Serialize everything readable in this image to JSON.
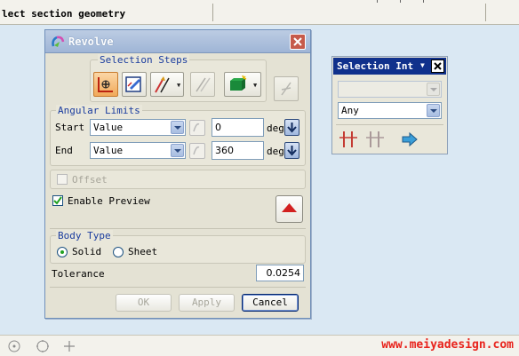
{
  "cue_line": {
    "text": "lect section geometry"
  },
  "dialog": {
    "title": "Revolve",
    "selection_steps": {
      "title": "Selection Steps"
    },
    "angular_limits": {
      "title": "Angular Limits",
      "start": {
        "label": "Start",
        "mode": "Value",
        "value": "0",
        "unit": "deg"
      },
      "end": {
        "label": "End",
        "mode": "Value",
        "value": "360",
        "unit": "deg"
      }
    },
    "offset": {
      "label": "Offset",
      "checked": false,
      "enabled": false
    },
    "enable_preview": {
      "label": "Enable Preview",
      "checked": true
    },
    "body_type": {
      "title": "Body Type",
      "options": [
        "Solid",
        "Sheet"
      ],
      "selected": "Solid"
    },
    "tolerance": {
      "label": "Tolerance",
      "value": "0.0254"
    },
    "buttons": {
      "ok": "OK",
      "apply": "Apply",
      "cancel": "Cancel"
    }
  },
  "selection_intent": {
    "title": "Selection Int",
    "filter_value": "",
    "rule_value": "Any"
  },
  "watermark": "www.meiyadesign.com",
  "colors": {
    "title_bar": "#9fb5d6",
    "group_title_text": "#1a3c9e",
    "selection_bar_title": "#10318c",
    "watermark": "#e8231c"
  }
}
